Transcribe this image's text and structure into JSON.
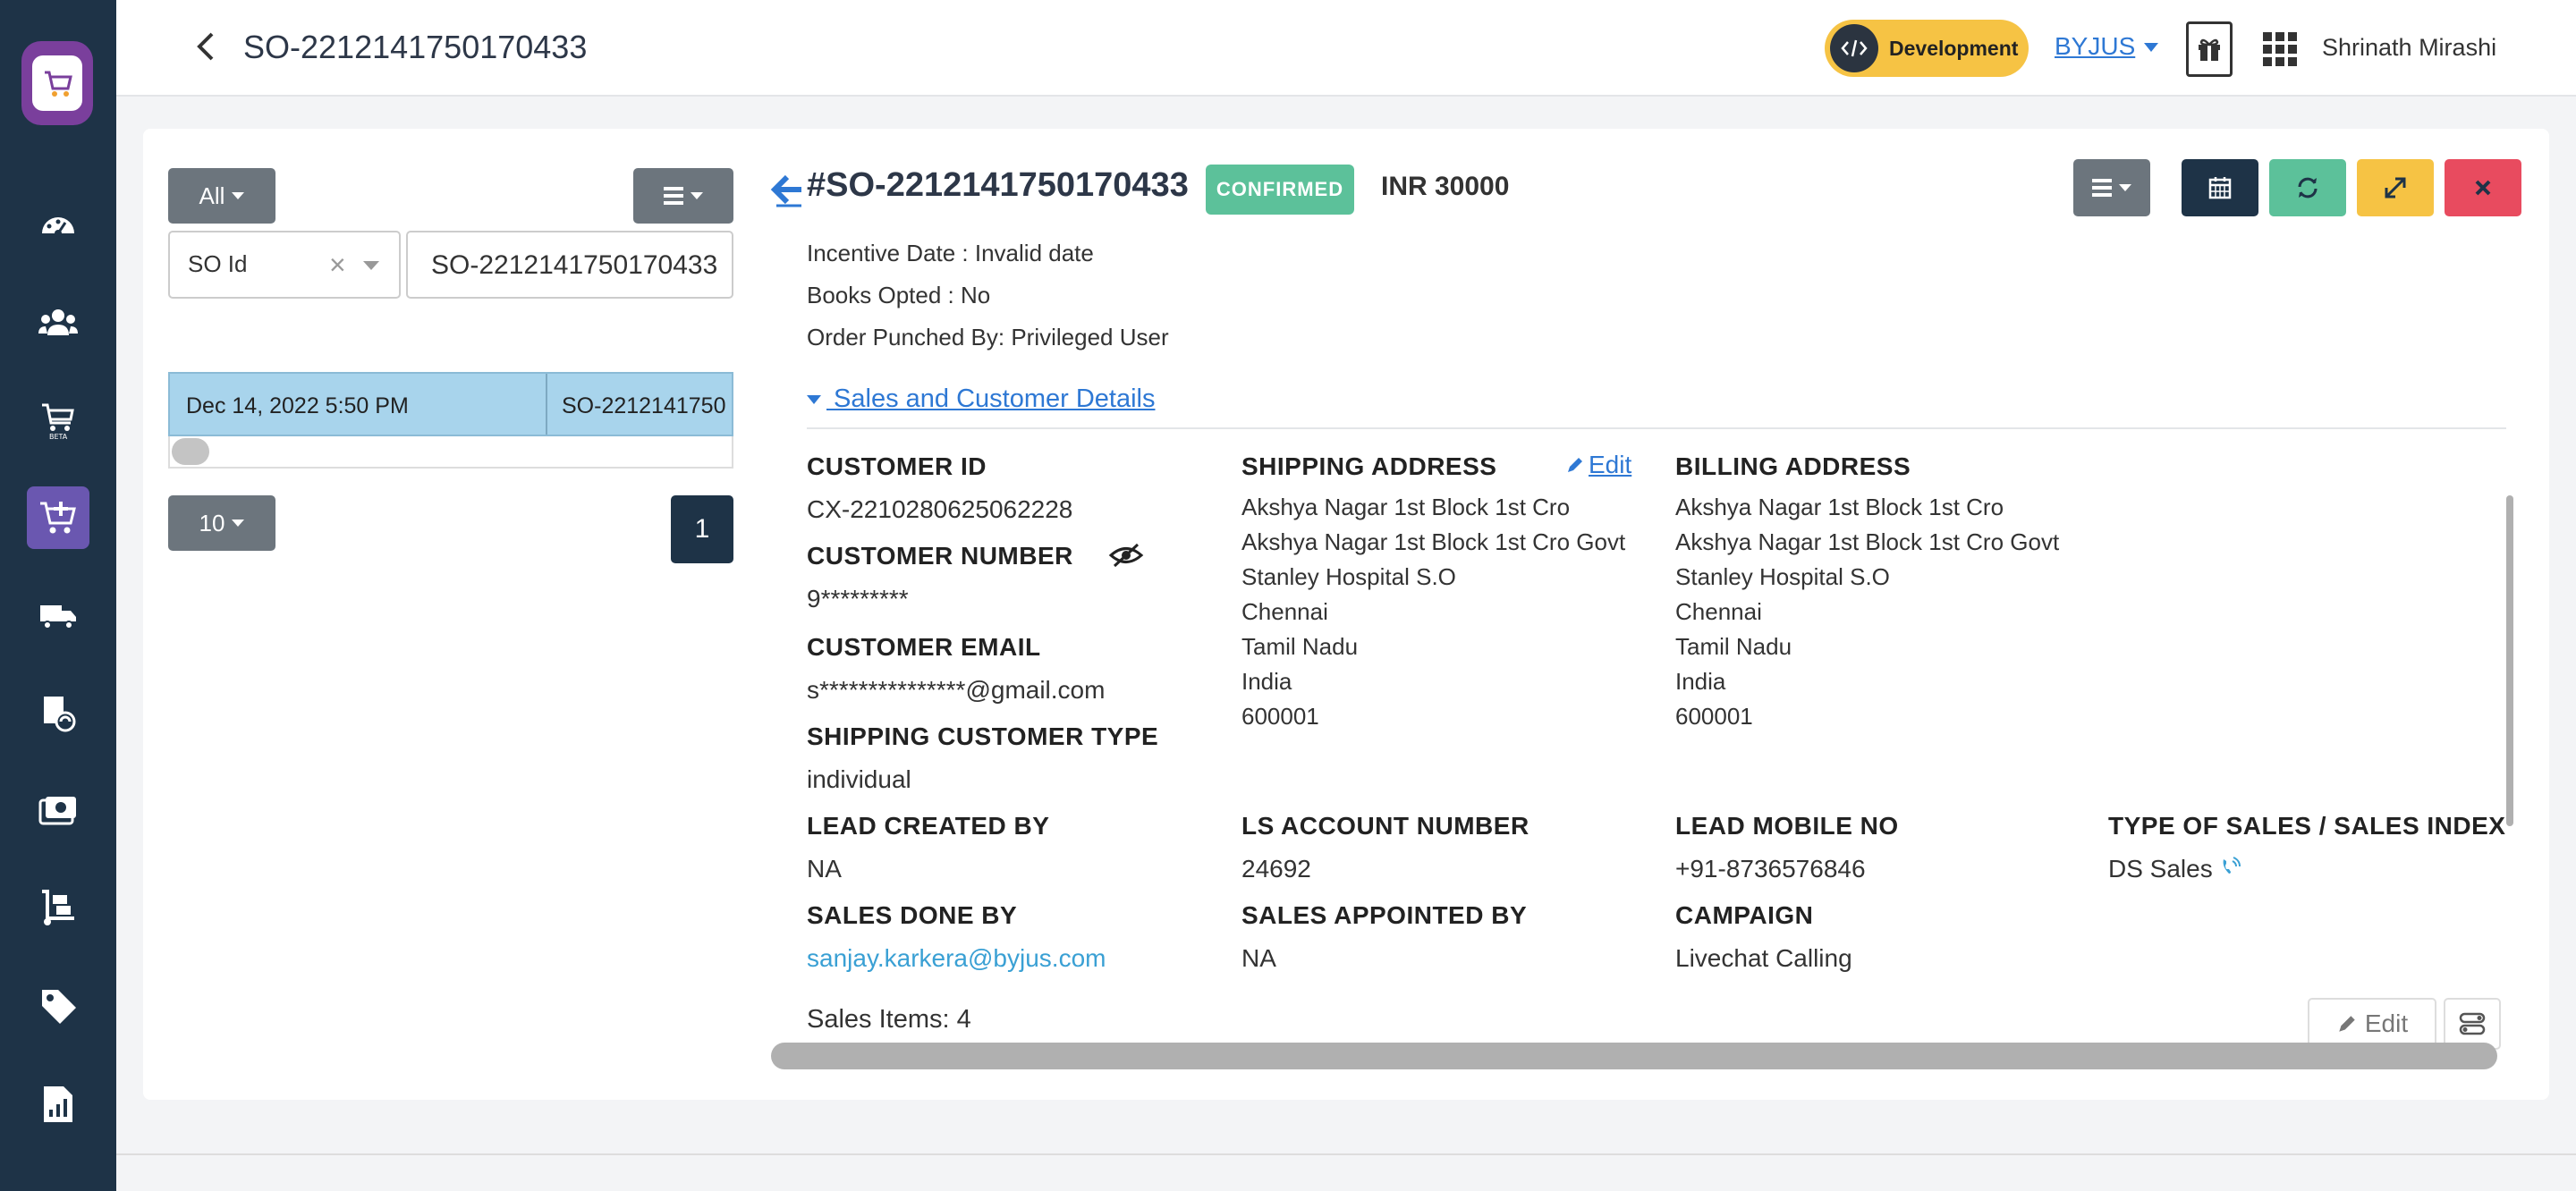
{
  "header": {
    "title": "SO-2212141750170433",
    "env_badge": "Development",
    "org": "BYJUS",
    "user": "Shrinath Mirashi"
  },
  "sidebar": {
    "items": [
      {
        "icon": "dashboard-icon"
      },
      {
        "icon": "users-icon"
      },
      {
        "icon": "beta-sales-icon",
        "label": "BETA"
      },
      {
        "icon": "cart-plus-icon",
        "active": true
      },
      {
        "icon": "delivery-truck-icon"
      },
      {
        "icon": "box-refresh-icon"
      },
      {
        "icon": "payment-icon"
      },
      {
        "icon": "dolly-icon"
      },
      {
        "icon": "tag-icon"
      },
      {
        "icon": "report-icon"
      }
    ]
  },
  "left_panel": {
    "filter_label": "All",
    "select_field": "SO Id",
    "search_value": "SO-2212141750170433",
    "results": [
      {
        "date": "Dec 14, 2022 5:50 PM",
        "so_id": "SO-2212141750"
      }
    ],
    "page_size": "10",
    "current_page": "1"
  },
  "detail": {
    "so_number": "#SO-2212141750170433",
    "status": "CONFIRMED",
    "amount": "INR 30000",
    "incentive_date": "Incentive Date : Invalid date",
    "books_opted": "Books Opted : No",
    "order_punched_by": "Order Punched By: Privileged User",
    "section_toggle": " Sales and Customer Details",
    "customer_id_label": "CUSTOMER ID",
    "customer_id": "CX-2210280625062228",
    "customer_number_label": "CUSTOMER NUMBER",
    "customer_number": "9*********",
    "customer_email_label": "CUSTOMER EMAIL",
    "customer_email": "s***************@gmail.com",
    "shipping_customer_type_label": "SHIPPING CUSTOMER TYPE",
    "shipping_customer_type": "individual",
    "shipping_address_label": "SHIPPING ADDRESS",
    "edit_label": "Edit",
    "shipping_address": [
      "Akshya Nagar 1st Block 1st Cro",
      "Akshya Nagar 1st Block 1st Cro Govt",
      "Stanley Hospital S.O",
      "Chennai",
      "Tamil Nadu",
      "India",
      "600001"
    ],
    "billing_address_label": "BILLING ADDRESS",
    "billing_address": [
      "Akshya Nagar 1st Block 1st Cro",
      "Akshya Nagar 1st Block 1st Cro Govt",
      "Stanley Hospital S.O",
      "Chennai",
      "Tamil Nadu",
      "India",
      "600001"
    ],
    "lead_created_by_label": "LEAD CREATED BY",
    "lead_created_by": "NA",
    "ls_account_number_label": "LS ACCOUNT NUMBER",
    "ls_account_number": "24692",
    "lead_mobile_no_label": "LEAD MOBILE NO",
    "lead_mobile_no": "+91-8736576846",
    "type_of_sales_label": "TYPE OF SALES / SALES INDEX",
    "type_of_sales": "DS Sales",
    "sales_done_by_label": "SALES DONE BY",
    "sales_done_by": "sanjay.karkera@byjus.com",
    "sales_appointed_by_label": "SALES APPOINTED BY",
    "sales_appointed_by": "NA",
    "campaign_label": "CAMPAIGN",
    "campaign": "Livechat Calling",
    "sales_items": "Sales Items: 4",
    "items_edit_label": "Edit"
  },
  "colors": {
    "sidebar": "#1e3347",
    "active_nav": "#6a57b0",
    "confirmed": "#5cc19a",
    "dev_badge": "#f6c344",
    "link": "#2e78d4",
    "btn_green": "#5cc19a",
    "btn_yellow": "#f6c344",
    "btn_red": "#e84b5f"
  }
}
